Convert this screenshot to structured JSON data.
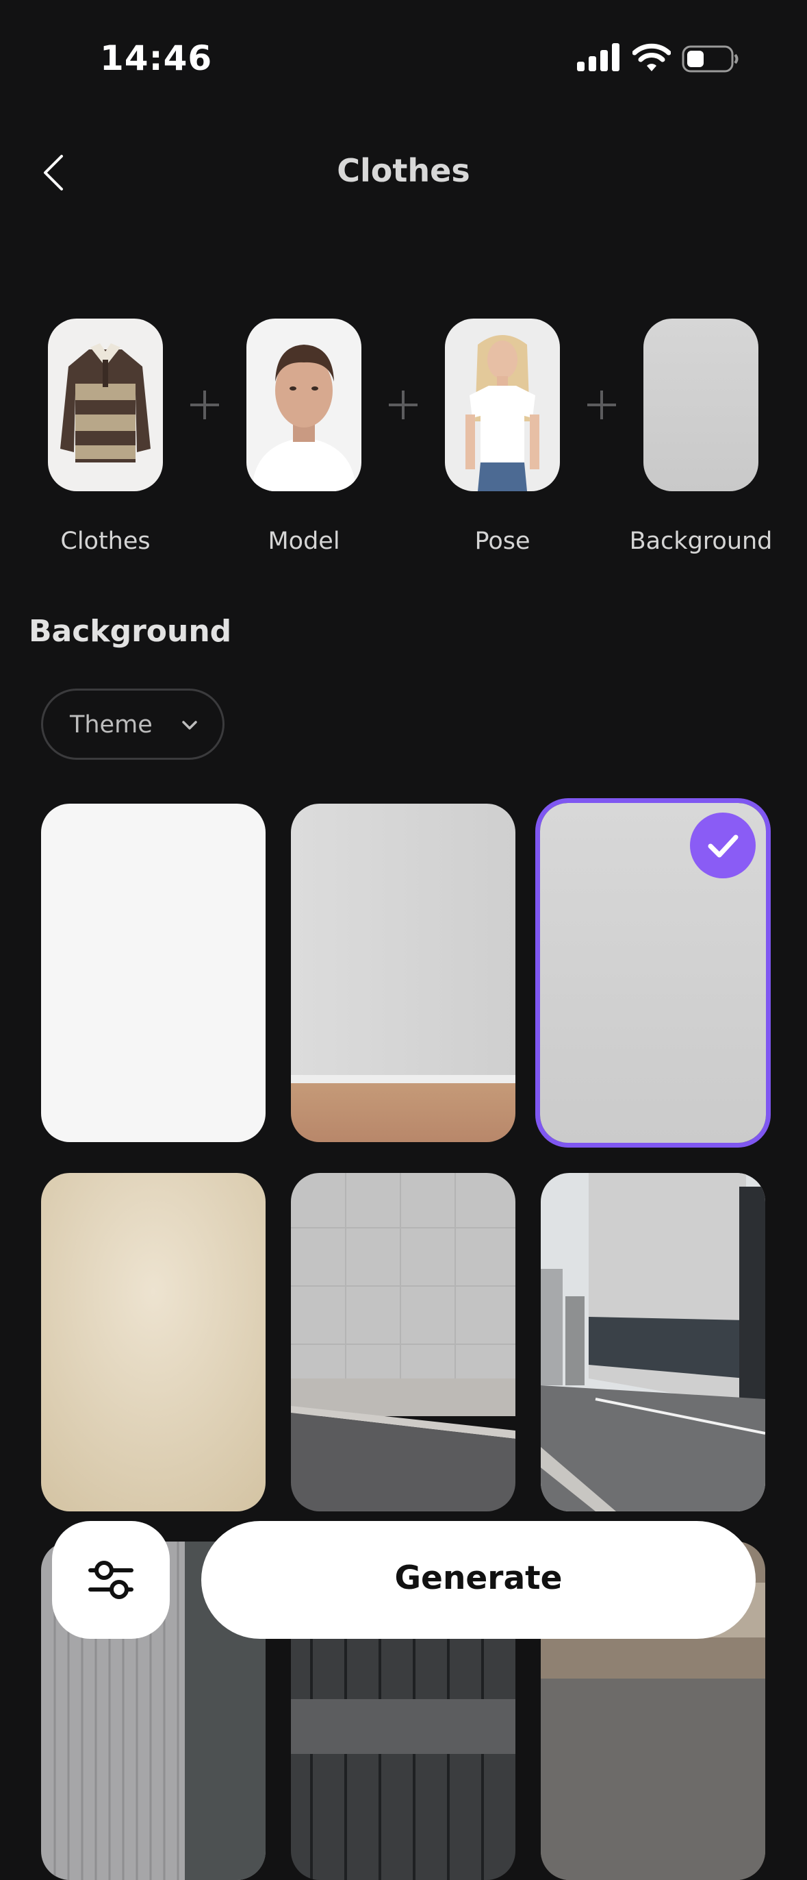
{
  "status_bar": {
    "time": "14:46"
  },
  "header": {
    "title": "Clothes",
    "back_icon": "chevron-left-icon"
  },
  "steps": [
    {
      "label": "Clothes"
    },
    {
      "label": "Model"
    },
    {
      "label": "Pose"
    },
    {
      "label": "Background"
    }
  ],
  "section": {
    "title": "Background"
  },
  "filter": {
    "label": "Theme",
    "icon": "chevron-down-icon"
  },
  "backgrounds": [
    {
      "theme": "plain white",
      "selected": false
    },
    {
      "theme": "grey wall with wooden floor",
      "selected": false
    },
    {
      "theme": "light grey studio",
      "selected": true
    },
    {
      "theme": "beige studio",
      "selected": false
    },
    {
      "theme": "concrete wall and street",
      "selected": false
    },
    {
      "theme": "city street with buildings",
      "selected": false
    }
  ],
  "actions": {
    "generate_label": "Generate",
    "settings_icon": "sliders-icon"
  },
  "colors": {
    "accent": "#8a5cf5",
    "background": "#121213"
  }
}
